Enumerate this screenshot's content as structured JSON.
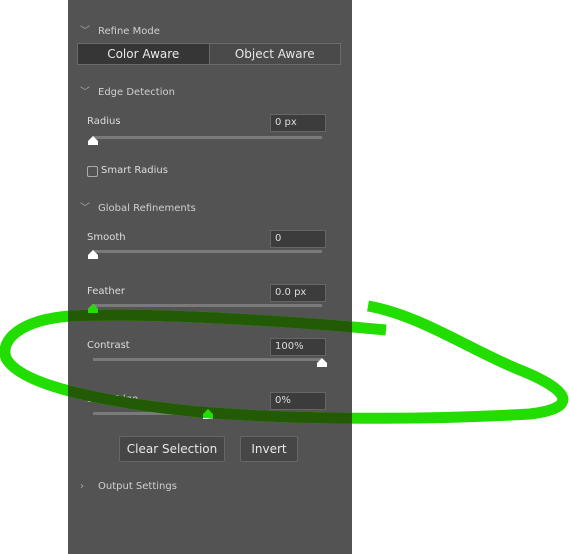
{
  "refine_mode": {
    "title": "Refine Mode",
    "options": [
      "Color Aware",
      "Object Aware"
    ],
    "selected": "Color Aware"
  },
  "edge_detection": {
    "title": "Edge Detection",
    "radius": {
      "label": "Radius",
      "value": "0 px",
      "fraction": 0
    },
    "smart_radius": {
      "label": "Smart Radius",
      "checked": false
    }
  },
  "global_refinements": {
    "title": "Global Refinements",
    "smooth": {
      "label": "Smooth",
      "value": "0",
      "fraction": 0
    },
    "feather": {
      "label": "Feather",
      "value": "0.0 px",
      "fraction": 0
    },
    "contrast": {
      "label": "Contrast",
      "value": "100%",
      "fraction": 1
    },
    "shift_edge": {
      "label": "Shift Edge",
      "value": "0%",
      "fraction": 0.5
    }
  },
  "buttons": {
    "clear": "Clear Selection",
    "invert": "Invert"
  },
  "output_settings": {
    "title": "Output Settings"
  },
  "annotation_color": "#22dd00"
}
